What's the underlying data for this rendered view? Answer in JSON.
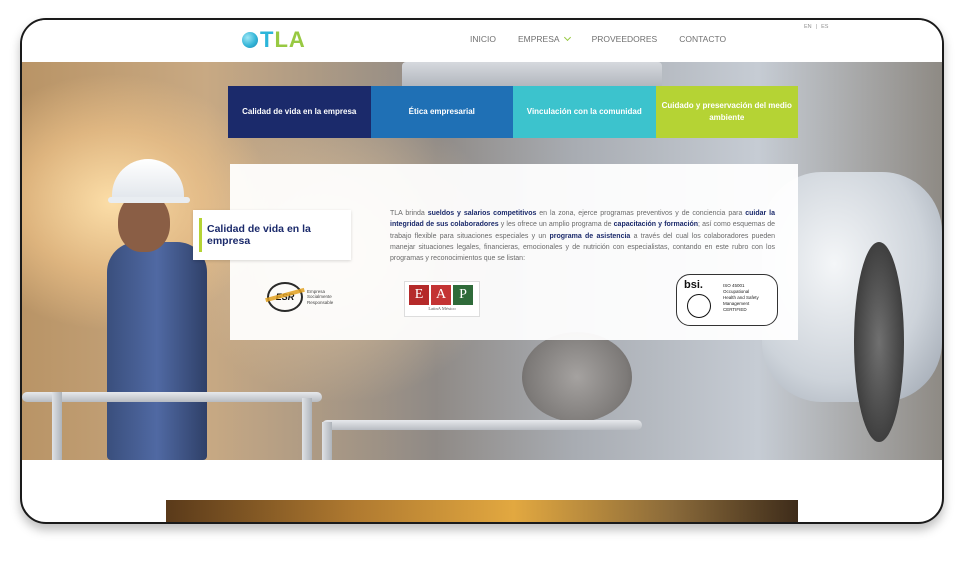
{
  "header": {
    "logo_part1": "T",
    "logo_part2": "LA",
    "nav": [
      "INICIO",
      "EMPRESA",
      "PROVEEDORES",
      "CONTACTO"
    ],
    "lang": [
      "EN",
      "|",
      "ES"
    ]
  },
  "tabs": [
    {
      "label": "Calidad de vida en la empresa",
      "color": "#1b2a6b"
    },
    {
      "label": "Ética empresarial",
      "color": "#1f70b5"
    },
    {
      "label": "Vinculación con la comunidad",
      "color": "#3cc3cd"
    },
    {
      "label": "Cuidado y preservación del medio ambiente",
      "color": "#b5d334"
    }
  ],
  "content": {
    "subtitle": "Calidad de vida en la empresa",
    "paragraph": {
      "p1": "TLA brinda ",
      "b1": "sueldos y salarios competitivos",
      "p2": " en la zona, ejerce programas preventivos y de conciencia para ",
      "b2": "cuidar la integridad de sus colaboradores",
      "p3": " y les ofrece un amplio programa de ",
      "b3": "capacitación y formación",
      "p4": "; así como esquemas de trabajo flexible para situaciones especiales y un ",
      "b4": "programa de asistencia",
      "p5": " a través del cual los colaboradores pueden manejar situaciones legales, financieras, emocionales y de nutrición con especialistas, contando en este rubro con los programas y reconocimientos que se listan:"
    }
  },
  "logos": {
    "esr_mark": "ESR",
    "esr_lines": [
      "Empresa",
      "Socialmente",
      "Responsable"
    ],
    "eap_letters": [
      "E",
      "A",
      "P"
    ],
    "eap_sub": "LatinA México",
    "bsi_name": "bsi.",
    "bsi_lines": [
      "ISO 45001",
      "Occupational",
      "Health and Safety",
      "Management",
      "CERTIFIED"
    ]
  }
}
